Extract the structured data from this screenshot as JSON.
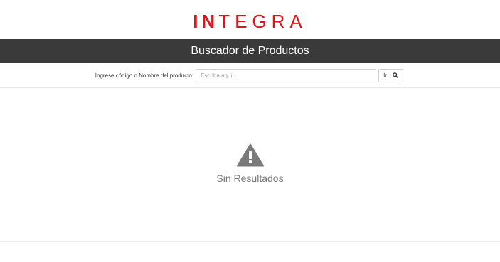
{
  "brand": {
    "logo_bold": "IN",
    "logo_light": "TEGRA",
    "logo_color": "#e0121a"
  },
  "header": {
    "title": "Buscador de Productos",
    "background": "#3a3a3a"
  },
  "search": {
    "label": "Ingrese código o Nombre del producto:",
    "placeholder": "Escriba aqui...",
    "value": "",
    "button_label": "Ir...",
    "button_icon": "search-icon"
  },
  "results": {
    "empty_icon": "warning-icon",
    "empty_message": "Sin Resultados"
  }
}
